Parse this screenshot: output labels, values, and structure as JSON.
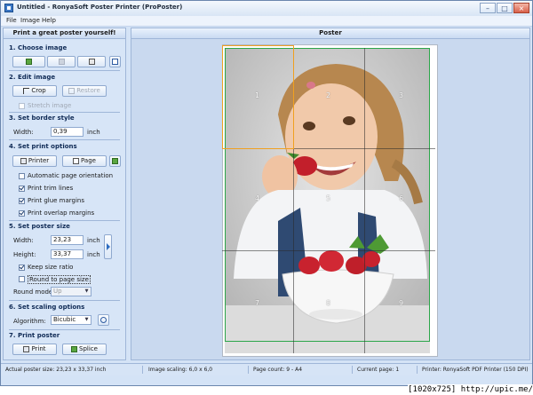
{
  "window": {
    "title": "Untitled - RonyaSoft Poster Printer (ProPoster)"
  },
  "menu": [
    "File",
    "Image",
    "Help"
  ],
  "left_panel": {
    "header": "Print a great poster yourself!",
    "sections": {
      "s1": "1. Choose image",
      "s2": "2. Edit image",
      "s3": "3. Set border style",
      "s4": "4. Set print options",
      "s5": "5. Set poster size",
      "s6": "6. Set scaling options",
      "s7": "7. Print poster"
    },
    "crop_label": "Crop",
    "restore_label": "Restore",
    "stretch_label": "Stretch image",
    "border_width_label": "Width:",
    "border_width_value": "0,39",
    "border_unit": "inch",
    "printer_label": "Printer",
    "page_label": "Page",
    "auto_orientation": "Automatic page orientation",
    "print_trim": "Print trim lines",
    "print_glue": "Print glue margins",
    "print_overlap": "Print overlap margins",
    "poster_width_label": "Width:",
    "poster_width_value": "23,23",
    "poster_height_label": "Height:",
    "poster_height_value": "33,37",
    "poster_unit": "inch",
    "keep_ratio": "Keep size ratio",
    "round_to_page": "Round to page size",
    "round_mode_label": "Round mode:",
    "round_mode_value": "Up",
    "algorithm_label": "Algorithm:",
    "algorithm_value": "Bicubic",
    "print_label": "Print",
    "splice_label": "Splice"
  },
  "content": {
    "header": "Poster",
    "page_numbers": [
      "1",
      "2",
      "3",
      "4",
      "5",
      "6",
      "7",
      "8",
      "9"
    ]
  },
  "status": {
    "poster_size": "Actual poster size: 23,23 x 33,37 inch",
    "image_scaling": "Image scaling: 6,0 x 6,0",
    "page_count": "Page count: 9 - A4",
    "current_page": "Current page: 1",
    "printer": "Printer: RonyaSoft PDF Printer (150 DPI)"
  },
  "watermark": "[1020x725] http://upic.me/",
  "colors": {
    "accent": "#3c78c6",
    "highlight": "#f0a020",
    "photo_bg": "#c8c8c8"
  }
}
